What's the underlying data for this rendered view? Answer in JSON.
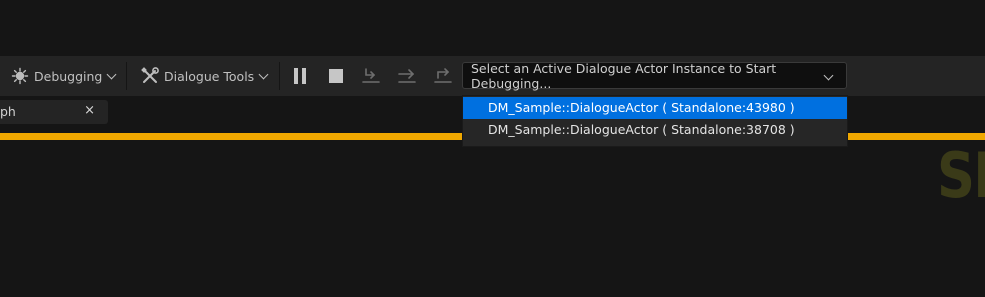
{
  "toolbar": {
    "debugging_label": "Debugging",
    "dialogue_tools_label": "Dialogue Tools",
    "icons": [
      "bug-icon",
      "wrench-screwdriver-icon",
      "pause-icon",
      "stop-icon",
      "step-into-icon",
      "step-over-icon",
      "step-out-icon"
    ]
  },
  "instance_select": {
    "placeholder": "Select an Active Dialogue Actor Instance to Start Debugging..."
  },
  "dropdown": {
    "items": [
      {
        "label": "DM_Sample::DialogueActor ( Standalone:43980 )",
        "selected": true
      },
      {
        "label": "DM_Sample::DialogueActor ( Standalone:38708 )",
        "selected": false
      }
    ]
  },
  "tab": {
    "label": "ph",
    "close_glyph": "×"
  },
  "graph": {
    "watermark_text": "SI"
  },
  "colors": {
    "accent": "#f0a800",
    "selection": "#0070e0",
    "background": "#151515",
    "toolbar": "#242424"
  }
}
